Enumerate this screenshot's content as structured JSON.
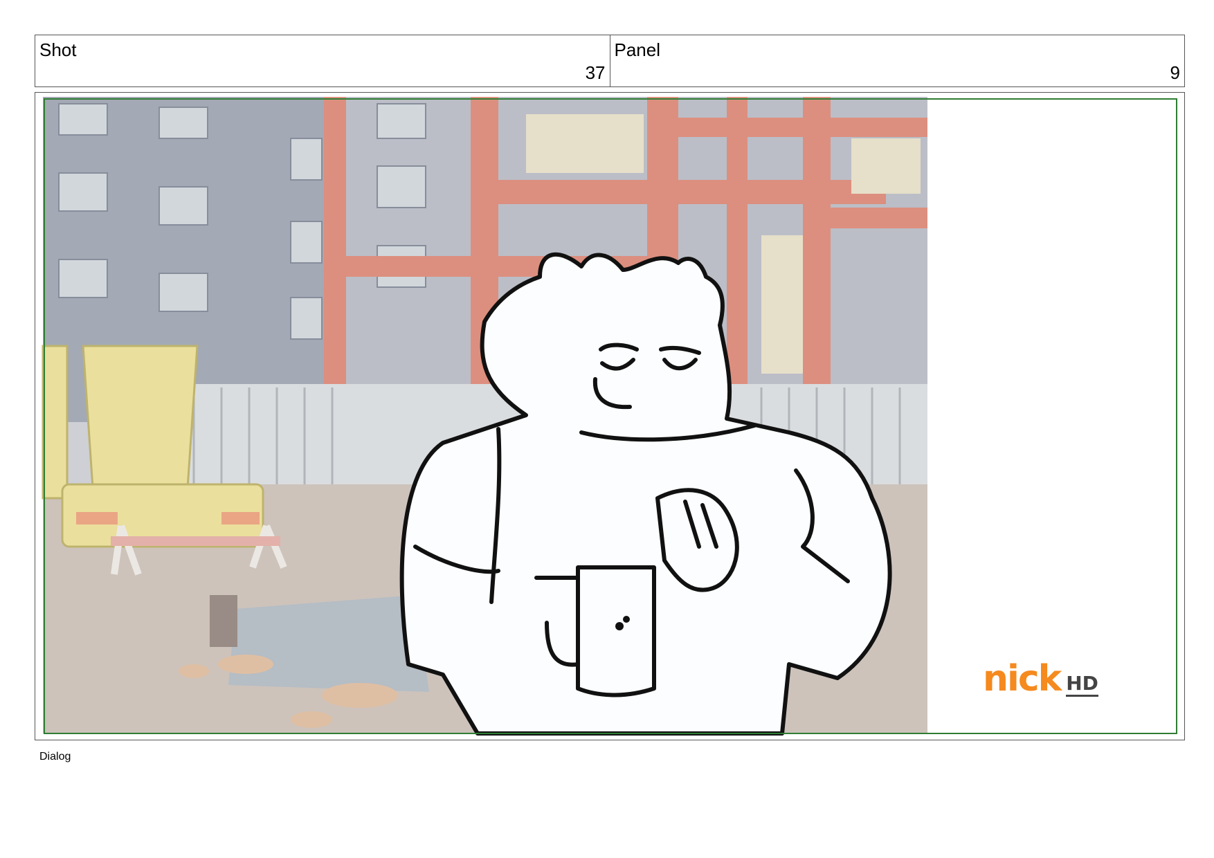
{
  "header": {
    "shot_label": "Shot",
    "shot_value": "37",
    "panel_label": "Panel",
    "panel_value": "9"
  },
  "logo": {
    "brand": "nick",
    "suffix": "HD"
  },
  "dialog": {
    "label": "Dialog"
  }
}
